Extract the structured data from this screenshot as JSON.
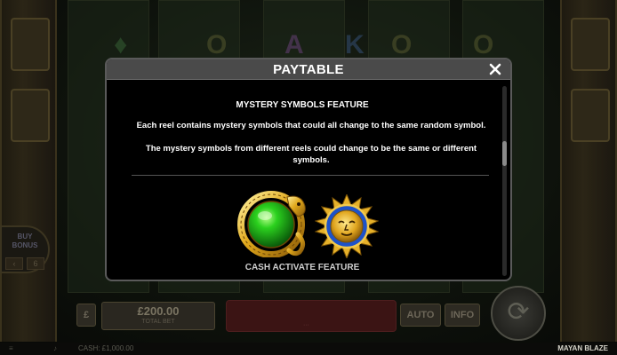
{
  "modal": {
    "title": "PAYTABLE",
    "close_icon": "close-icon",
    "section_title": "MYSTERY SYMBOLS FEATURE",
    "paragraph_1": "Each reel contains mystery symbols that could all change to the same random symbol.",
    "paragraph_2": "The mystery symbols from different reels could change to be the same or different symbols.",
    "symbols": [
      "green-orb-serpent-icon",
      "blue-sun-face-icon"
    ],
    "feature_label": "CASH ACTIVATE FEATURE"
  },
  "background": {
    "buy_bonus_label": "BUY BONUS",
    "buy_bonus_value": "6",
    "stake_value": "£200.00",
    "stake_sub": "TOTAL BET",
    "auto_label": "AUTO",
    "info_label": "INFO",
    "spin_icon": "spin-arrows-icon"
  },
  "statusbar": {
    "cash": "CASH: £1,000.00",
    "game_name": "MAYAN BLAZE"
  },
  "colors": {
    "modal_bg": "#000000",
    "header_bg": "#4a4a4a",
    "text": "#ffffff",
    "feature_label": "#cfcfcf"
  }
}
